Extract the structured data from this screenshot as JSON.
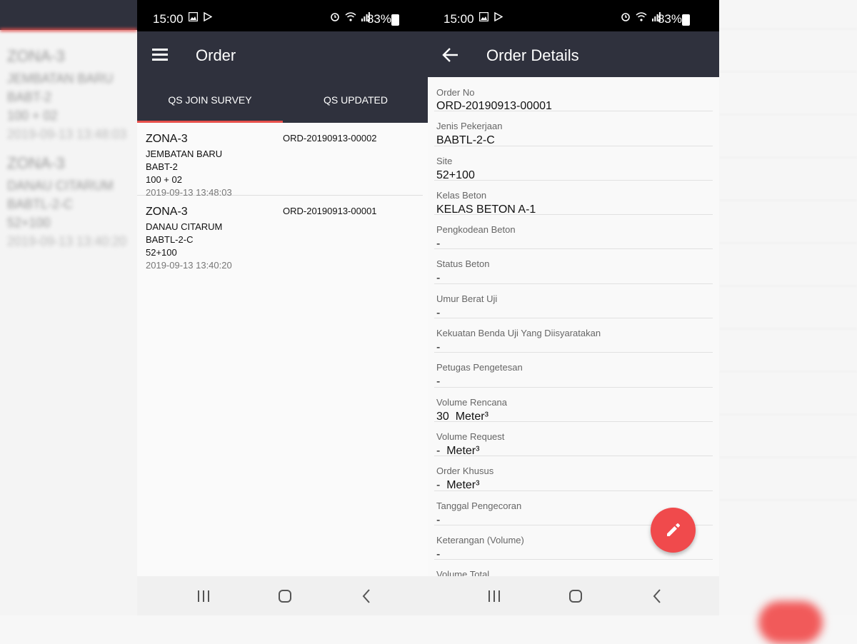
{
  "background": {
    "left_ghost_lines": [
      "ZONA-3",
      "JEMBATAN BARU",
      "BABT-2",
      "100 + 02",
      "2019-09-13 13:48:03",
      "ZONA-3",
      "DANAU CITARUM",
      "BABTL-2-C",
      "52+100",
      "2019-09-13 13:40:20"
    ]
  },
  "status_bar": {
    "time": "15:00",
    "battery": "83%",
    "left_icons": [
      "image-icon",
      "play-store-icon"
    ],
    "right_icons": [
      "alarm-icon",
      "wifi-icon",
      "signal-icon",
      "battery-icon"
    ]
  },
  "order_screen": {
    "title": "Order",
    "tabs": [
      {
        "label": "QS JOIN SURVEY",
        "active": true
      },
      {
        "label": "QS UPDATED",
        "active": false
      }
    ],
    "orders": [
      {
        "zona": "ZONA-3",
        "lokasi": "JEMBATAN BARU",
        "pekerjaan": "BABT-2",
        "site": "100 + 02",
        "date": "2019-09-13 13:48:03",
        "order_no": "ORD-20190913-00002"
      },
      {
        "zona": "ZONA-3",
        "lokasi": "DANAU CITARUM",
        "pekerjaan": "BABTL-2-C",
        "site": "52+100",
        "date": "2019-09-13 13:40:20",
        "order_no": "ORD-20190913-00001"
      }
    ]
  },
  "details_screen": {
    "title": "Order Details",
    "fields": [
      {
        "label": "Order No",
        "value": "ORD-20190913-00001"
      },
      {
        "label": "Jenis Pekerjaan",
        "value": "BABTL-2-C"
      },
      {
        "label": "Site",
        "value": "52+100"
      },
      {
        "label": "Kelas Beton",
        "value": "KELAS BETON A-1"
      },
      {
        "label": "Pengkodean Beton",
        "value": "-"
      },
      {
        "label": "Status Beton",
        "value": "-"
      },
      {
        "label": "Umur Berat Uji",
        "value": "-"
      },
      {
        "label": "Kekuatan Benda Uji Yang Diisyaratakan",
        "value": "-"
      },
      {
        "label": "Petugas Pengetesan",
        "value": "-"
      },
      {
        "label": "Volume Rencana",
        "value": "30  Meter³"
      },
      {
        "label": "Volume Request",
        "value": "-  Meter³"
      },
      {
        "label": "Order Khusus",
        "value": "-  Meter³"
      },
      {
        "label": "Tanggal Pengecoran",
        "value": "-"
      },
      {
        "label": "Keterangan (Volume)",
        "value": "-"
      },
      {
        "label": "Volume Total",
        "value": ""
      }
    ],
    "fab_icon": "edit-pencil-icon"
  },
  "navigation_bar": {
    "icons": [
      "recent-apps-icon",
      "home-icon",
      "back-icon"
    ]
  },
  "colors": {
    "app_bar": "#2f313d",
    "accent": "#e8504c",
    "fab": "#f04a4c",
    "status_bar": "#000000"
  }
}
